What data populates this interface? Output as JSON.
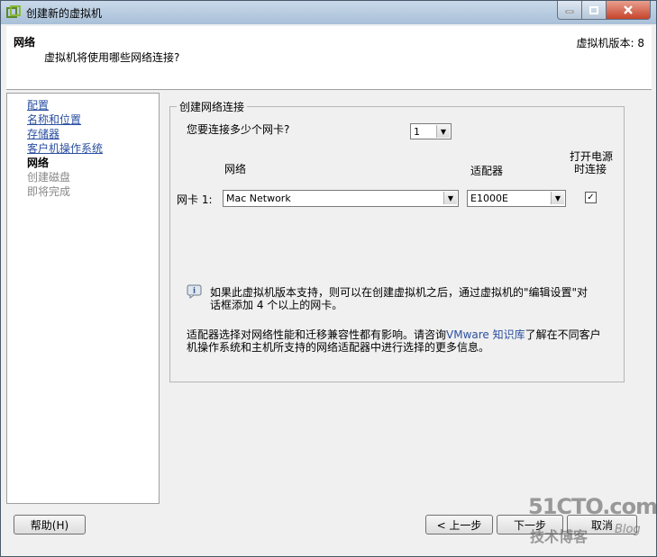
{
  "window": {
    "title": "创建新的虚拟机",
    "minimize_icon": "minimize-icon",
    "maximize_icon": "maximize-icon",
    "close_icon": "close-icon"
  },
  "header": {
    "title": "网络",
    "subtitle": "虚拟机将使用哪些网络连接?",
    "version": "虚拟机版本: 8"
  },
  "nav": {
    "items": [
      {
        "label": "配置",
        "state": "link"
      },
      {
        "label": "名称和位置",
        "state": "link"
      },
      {
        "label": "存储器",
        "state": "link"
      },
      {
        "label": "客户机操作系统",
        "state": "link"
      },
      {
        "label": "网络",
        "state": "current"
      },
      {
        "label": "创建磁盘",
        "state": "disabled"
      },
      {
        "label": "即将完成",
        "state": "disabled"
      }
    ]
  },
  "network_group": {
    "legend": "创建网络连接",
    "nic_count_label": "您要连接多少个网卡?",
    "nic_count_value": "1",
    "col_network": "网络",
    "col_adapter": "适配器",
    "col_power_on_line1": "打开电源",
    "col_power_on_line2": "时连接",
    "nic1_label": "网卡 1:",
    "nic1_network": "Mac Network",
    "nic1_adapter": "E1000E",
    "nic1_connect_checked": true,
    "info_line1": "如果此虚拟机版本支持，则可以在创建虚拟机之后，通过虚拟机的\"编辑设置\"对",
    "info_line2": "话框添加 4 个以上的网卡。",
    "adapter_note_part1": "适配器选择对网络性能和迁移兼容性都有影响。请咨询",
    "adapter_note_link": "VMware 知识库",
    "adapter_note_part2": "了解在不同客户",
    "adapter_note_line2": "机操作系统和主机所支持的网络适配器中进行选择的更多信息。"
  },
  "buttons": {
    "help": "帮助(H)",
    "back": "< 上一步",
    "next": "下一步",
    "cancel": "取消"
  },
  "watermark": {
    "site": "51CTO.com",
    "blog_cn": "技术博客",
    "blog_en": "Blog"
  },
  "colors": {
    "link": "#2a4fa0",
    "titlebar": "#b9cde2",
    "close_button": "#c6442c"
  }
}
